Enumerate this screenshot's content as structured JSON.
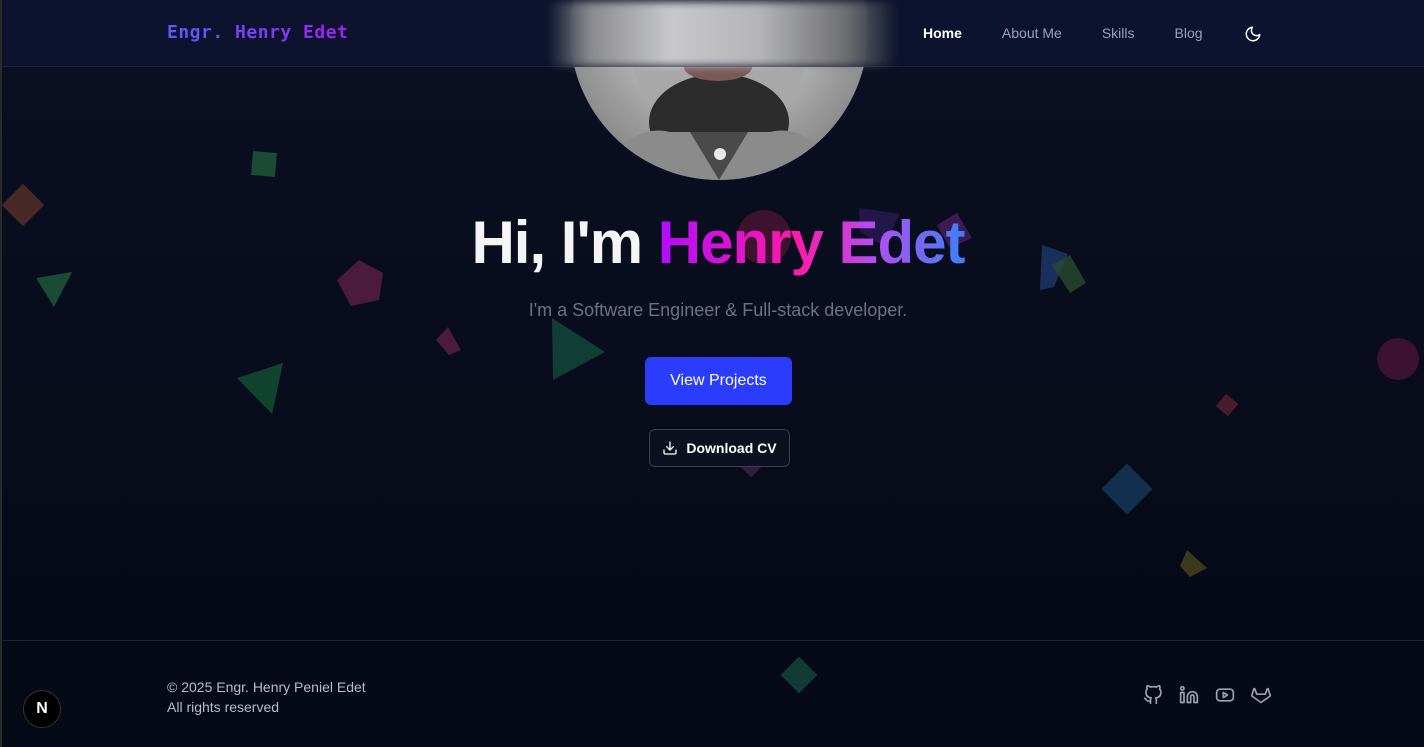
{
  "header": {
    "logo": "Engr. Henry Edet",
    "nav": [
      {
        "label": "Home",
        "active": true
      },
      {
        "label": "About Me",
        "active": false
      },
      {
        "label": "Skills",
        "active": false
      },
      {
        "label": "Blog",
        "active": false
      }
    ],
    "theme_toggle_icon": "moon-icon"
  },
  "hero": {
    "greeting": "Hi, I'm ",
    "name": "Henry Edet",
    "subtitle": "I'm a Software Engineer & Full-stack developer.",
    "primary_button": "View Projects",
    "secondary_button": "Download CV",
    "secondary_icon": "download-icon"
  },
  "footer": {
    "copyright_line1": "© 2025 Engr. Henry Peniel Edet",
    "copyright_line2": "All rights reserved",
    "socials": [
      "github-icon",
      "linkedin-icon",
      "youtube-icon",
      "gitlab-icon"
    ]
  },
  "badge": {
    "label": "N"
  },
  "colors": {
    "accent": "#2a3dff",
    "name_gradient": [
      "#b20cff",
      "#ff1aa6",
      "#3b82f6"
    ],
    "background": "#0a0f1f"
  }
}
